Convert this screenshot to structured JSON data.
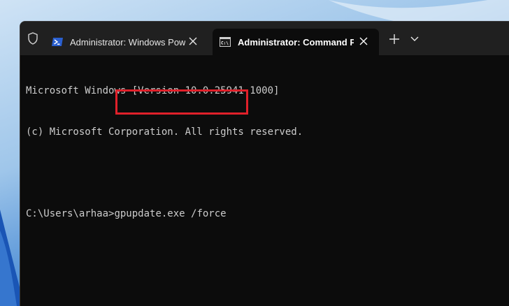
{
  "tabs": [
    {
      "label": "Administrator: Windows Power",
      "icon": "powershell-icon",
      "active": false
    },
    {
      "label": "Administrator: Command Pro",
      "icon": "command-prompt-icon",
      "active": true
    }
  ],
  "terminal": {
    "lines": [
      "Microsoft Windows [Version 10.0.25941.1000]",
      "(c) Microsoft Corporation. All rights reserved.",
      ""
    ],
    "prompt": "C:\\Users\\arhaa>",
    "command": "gpupdate.exe /force"
  },
  "colors": {
    "terminal_bg": "#0c0c0c",
    "titlebar_bg": "#202020",
    "terminal_text": "#cccccc",
    "highlight": "#e0202a"
  }
}
